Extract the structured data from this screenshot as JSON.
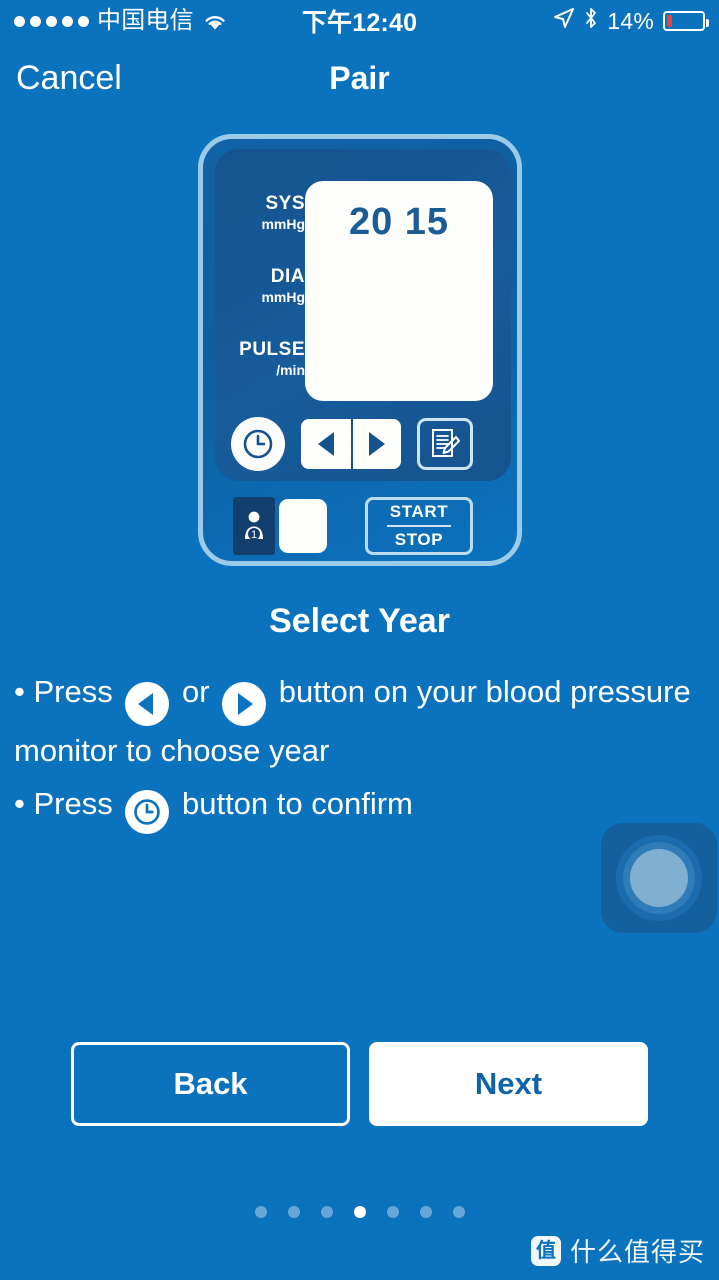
{
  "status_bar": {
    "signal_dots": 5,
    "carrier": "中国电信",
    "wifi_icon": "wifi-icon",
    "time": "下午12:40",
    "location_icon": "location-arrow-icon",
    "bluetooth_icon": "bluetooth-icon",
    "battery_percent": "14%",
    "battery_level": 14,
    "battery_color": "#e8453c"
  },
  "nav": {
    "cancel_label": "Cancel",
    "title": "Pair"
  },
  "device": {
    "measure_labels": [
      {
        "main": "SYS",
        "sub": "mmHg"
      },
      {
        "main": "DIA",
        "sub": "mmHg"
      },
      {
        "main": "PULSE",
        "sub": "/min"
      }
    ],
    "display_value": "20 15",
    "buttons": {
      "clock_icon": "clock-icon",
      "left_arrow_icon": "arrow-left-icon",
      "right_arrow_icon": "arrow-right-icon",
      "memo_icon": "memo-document-icon",
      "user_icon": "user-1-icon",
      "user_number": "1",
      "start_label": "START",
      "stop_label": "STOP"
    }
  },
  "content": {
    "step_title": "Select Year",
    "bullet1_prefix": "• Press",
    "bullet1_mid": "or",
    "bullet1_suffix": "button on your blood pressure monitor to choose year",
    "bullet2_prefix": "• Press",
    "bullet2_suffix": "button to confirm"
  },
  "touch_hint": {
    "icon": "touch-ripple-indicator"
  },
  "footer": {
    "back_label": "Back",
    "next_label": "Next"
  },
  "pager": {
    "total": 7,
    "active_index": 3
  },
  "watermark": {
    "logo_char": "值",
    "text": "什么值得买"
  },
  "colors": {
    "background": "#0b72be",
    "device_panel": "#15538f",
    "device_border": "#9ccbe8",
    "lcd_text": "#1b5c96",
    "accent_white": "#ffffff"
  }
}
